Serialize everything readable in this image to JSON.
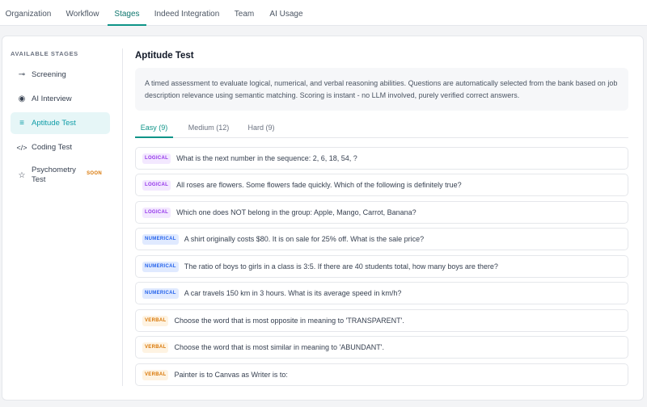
{
  "top_tabs": [
    {
      "label": "Organization"
    },
    {
      "label": "Workflow"
    },
    {
      "label": "Stages"
    },
    {
      "label": "Indeed Integration"
    },
    {
      "label": "Team"
    },
    {
      "label": "AI Usage"
    }
  ],
  "active_top_tab": "Stages",
  "sidebar": {
    "header": "AVAILABLE STAGES",
    "items": [
      {
        "label": "Screening",
        "icon": "screening-icon"
      },
      {
        "label": "AI Interview",
        "icon": "ai-interview-icon"
      },
      {
        "label": "Aptitude Test",
        "icon": "list-icon"
      },
      {
        "label": "Coding Test",
        "icon": "code-icon"
      },
      {
        "label": "Psychometry Test",
        "icon": "star-icon",
        "badge": "SOON"
      }
    ],
    "active": "Aptitude Test"
  },
  "main": {
    "title": "Aptitude Test",
    "description": "A timed assessment to evaluate logical, numerical, and verbal reasoning abilities. Questions are automatically selected from the bank based on job description relevance using semantic matching. Scoring is instant - no LLM involved, purely verified correct answers.",
    "difficulty_tabs": [
      {
        "label": "Easy (9)"
      },
      {
        "label": "Medium (12)"
      },
      {
        "label": "Hard (9)"
      }
    ],
    "active_difficulty": "Easy (9)",
    "questions": [
      {
        "category": "LOGICAL",
        "text": "What is the next number in the sequence: 2, 6, 18, 54, ?"
      },
      {
        "category": "LOGICAL",
        "text": "All roses are flowers. Some flowers fade quickly. Which of the following is definitely true?"
      },
      {
        "category": "LOGICAL",
        "text": "Which one does NOT belong in the group: Apple, Mango, Carrot, Banana?"
      },
      {
        "category": "NUMERICAL",
        "text": "A shirt originally costs $80. It is on sale for 25% off. What is the sale price?"
      },
      {
        "category": "NUMERICAL",
        "text": "The ratio of boys to girls in a class is 3:5. If there are 40 students total, how many boys are there?"
      },
      {
        "category": "NUMERICAL",
        "text": "A car travels 150 km in 3 hours. What is its average speed in km/h?"
      },
      {
        "category": "VERBAL",
        "text": "Choose the word that is most opposite in meaning to 'TRANSPARENT'."
      },
      {
        "category": "VERBAL",
        "text": "Choose the word that is most similar in meaning to 'ABUNDANT'."
      },
      {
        "category": "VERBAL",
        "text": "Painter is to Canvas as Writer is to:"
      }
    ]
  },
  "colors": {
    "accent": "#0d9488",
    "logical": "#9333ea",
    "numerical": "#2563eb",
    "verbal": "#d97706"
  }
}
